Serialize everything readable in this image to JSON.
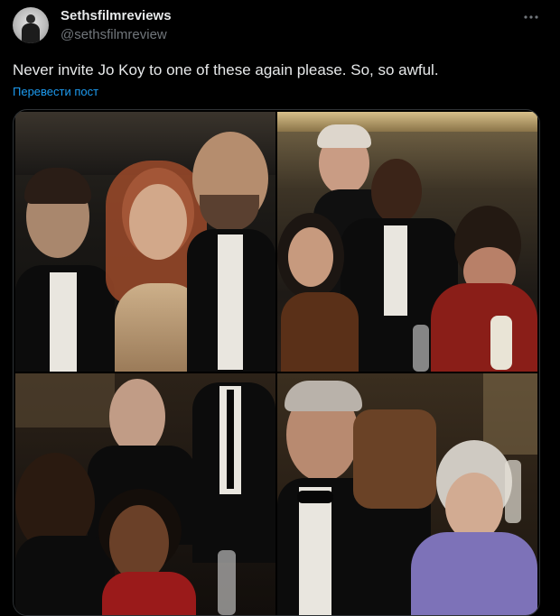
{
  "author": {
    "display_name": "Sethsfilmreviews",
    "handle": "@sethsfilmreview",
    "avatar_icon": "profile-photo-icon"
  },
  "menu": {
    "more_icon": "more-horizontal-icon"
  },
  "tweet": {
    "text": "Never invite Jo Koy to one of these again please. So, so awful.",
    "translate_label": "Перевести пост"
  },
  "media": {
    "photo_count": 4,
    "photos": [
      {
        "alt": ""
      },
      {
        "alt": ""
      },
      {
        "alt": ""
      },
      {
        "alt": ""
      }
    ]
  },
  "colors": {
    "background": "#000000",
    "text_primary": "#e7e9ea",
    "text_secondary": "#71767b",
    "link": "#1d9bf0",
    "border": "#2f3336"
  }
}
